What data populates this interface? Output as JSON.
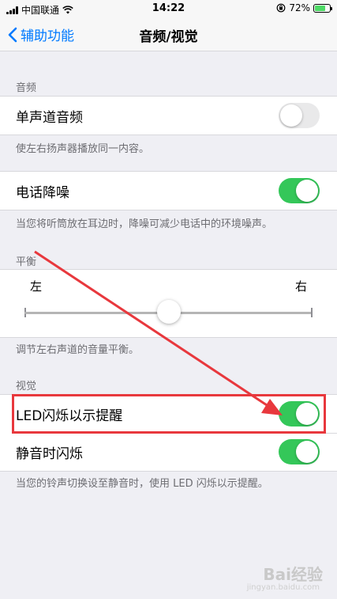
{
  "status": {
    "carrier": "中国联通",
    "time": "14:22",
    "battery_percent": "72%",
    "battery_level": 0.72
  },
  "nav": {
    "back_label": "辅助功能",
    "title": "音频/视觉"
  },
  "audio": {
    "header": "音频",
    "mono_label": "单声道音频",
    "mono_on": false,
    "mono_footer": "使左右扬声器播放同一内容。",
    "noise_label": "电话降噪",
    "noise_on": true,
    "noise_footer": "当您将听筒放在耳边时，降噪可减少电话中的环境噪声。"
  },
  "balance": {
    "header": "平衡",
    "left_label": "左",
    "right_label": "右",
    "value": 0.5,
    "footer": "调节左右声道的音量平衡。"
  },
  "visual": {
    "header": "视觉",
    "led_label": "LED闪烁以示提醒",
    "led_on": true,
    "silent_label": "静音时闪烁",
    "silent_on": true,
    "footer": "当您的铃声切换设至静音时，使用 LED 闪烁以示提醒。"
  },
  "watermark": {
    "text": "Bai经验",
    "sub": "jingyan.baidu.com"
  },
  "colors": {
    "accent": "#007aff",
    "toggle_on": "#34c759",
    "annotation": "#e8383d"
  }
}
